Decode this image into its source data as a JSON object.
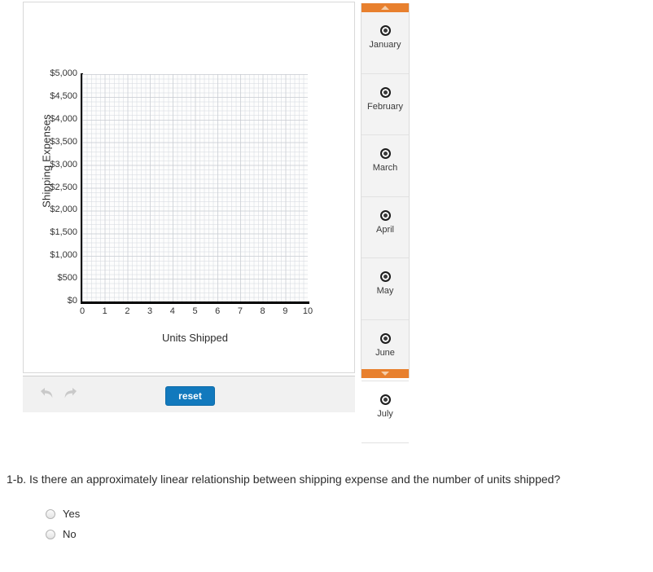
{
  "chart_data": {
    "type": "scatter",
    "title": "",
    "xlabel": "Units Shipped",
    "ylabel": "Shipping Expenses",
    "xlim": [
      0,
      10
    ],
    "ylim": [
      0,
      5000
    ],
    "x_ticks": [
      "0",
      "1",
      "2",
      "3",
      "4",
      "5",
      "6",
      "7",
      "8",
      "9",
      "10"
    ],
    "y_ticks": [
      "$5,000",
      "$4,500",
      "$4,000",
      "$3,500",
      "$3,000",
      "$2,500",
      "$2,000",
      "$1,500",
      "$1,000",
      "$500",
      "$0"
    ],
    "grid": true,
    "legend": "none",
    "series": [
      {
        "name": "Shipping Expenses",
        "points": []
      }
    ]
  },
  "chart_card": {
    "y_axis_title": "Shipping Expenses",
    "x_axis_title": "Units Shipped",
    "y_ticks": [
      "$5,000",
      "$4,500",
      "$4,000",
      "$3,500",
      "$3,000",
      "$2,500",
      "$2,000",
      "$1,500",
      "$1,000",
      "$500",
      "$0"
    ],
    "x_ticks": [
      "0",
      "1",
      "2",
      "3",
      "4",
      "5",
      "6",
      "7",
      "8",
      "9",
      "10"
    ]
  },
  "toolbar": {
    "undo_icon": "undo-arrow-icon",
    "redo_icon": "redo-arrow-icon",
    "reset_label": "reset",
    "reset_color": "#1279bd"
  },
  "palette": {
    "scroll_up_icon": "chevron-up-icon",
    "scroll_down_icon": "chevron-down-icon",
    "accent_color": "#e8802e",
    "marker_icon": "data-point-marker-icon",
    "items": [
      {
        "label": "January"
      },
      {
        "label": "February"
      },
      {
        "label": "March"
      },
      {
        "label": "April"
      },
      {
        "label": "May"
      },
      {
        "label": "June"
      },
      {
        "label": "July"
      }
    ]
  },
  "question": {
    "text": "1-b. Is there an approximately linear relationship between shipping expense and the number of units shipped?",
    "options": [
      {
        "label": "Yes",
        "selected": false
      },
      {
        "label": "No",
        "selected": false
      }
    ]
  }
}
